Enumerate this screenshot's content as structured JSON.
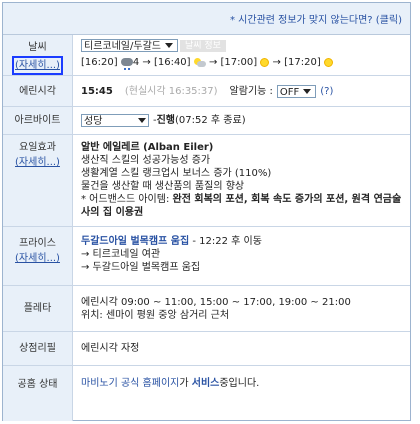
{
  "top_link": "* 시간관련 정보가 맞지 않는다면? (클릭)",
  "more_label": "(자세히...)",
  "weather": {
    "label": "날씨",
    "region_select": "티르코네일/두갈드",
    "region_button": "날씨 정보",
    "forecast": [
      {
        "time": "[16:20]",
        "icon": "storm-cloud-icon",
        "value": "4"
      },
      {
        "time": "[16:40]",
        "icon": "partly-cloudy-icon",
        "value": ""
      },
      {
        "time": "[17:00]",
        "icon": "sun-icon",
        "value": ""
      },
      {
        "time": "[17:20]",
        "icon": "sun-icon",
        "value": ""
      }
    ],
    "arrow": "→"
  },
  "erin_time": {
    "label": "에린시각",
    "time": "15:45",
    "real_time": "(현실시각 16:35:37)",
    "alarm_label": "알람기능 :",
    "alarm_select": "OFF",
    "help": "(?)"
  },
  "parttime": {
    "label": "아르바이트",
    "select": "성당",
    "status_prefix": "- ",
    "status": "진행",
    "detail": " (07:52 후 종료)"
  },
  "day_effect": {
    "label": "요일효과",
    "title": "알반 에일레르 (Alban Eiler)",
    "lines": [
      "생산직 스킬의 성공가능성 증가",
      "생활계열 스킬 랭크업시 보너스 증가 (110%)",
      "물건을 생산할 때 생산품의 품질의 향상"
    ],
    "adv_prefix": "* 어드밴스드 아이템: ",
    "adv_items": "완전 회복의 포션, 회복 속도 증가의 포션, 원격 연금술사의 집 이용권"
  },
  "price": {
    "label": "프라이스",
    "location": "두갈드아일 벌목캠프 움집",
    "move": " - 12:22 후 이동",
    "next": [
      "→ 티르코네일 여관",
      "→ 두갈드아일 벌목캠프 움집"
    ]
  },
  "pleta": {
    "label": "플레타",
    "times": "에린시각 09:00 ~ 11:00, 15:00 ~ 17:00, 19:00 ~ 21:00",
    "location": "위치: 센마이 평원 중앙 삼거리 근처"
  },
  "shop_refill": {
    "label": "상점리필",
    "value": "에린시각 자정"
  },
  "server_status": {
    "label": "공홈 상태",
    "link": "마비노기 공식 홈페이지",
    "mid": "가 ",
    "status": "서비스",
    "suffix": "중입니다."
  }
}
